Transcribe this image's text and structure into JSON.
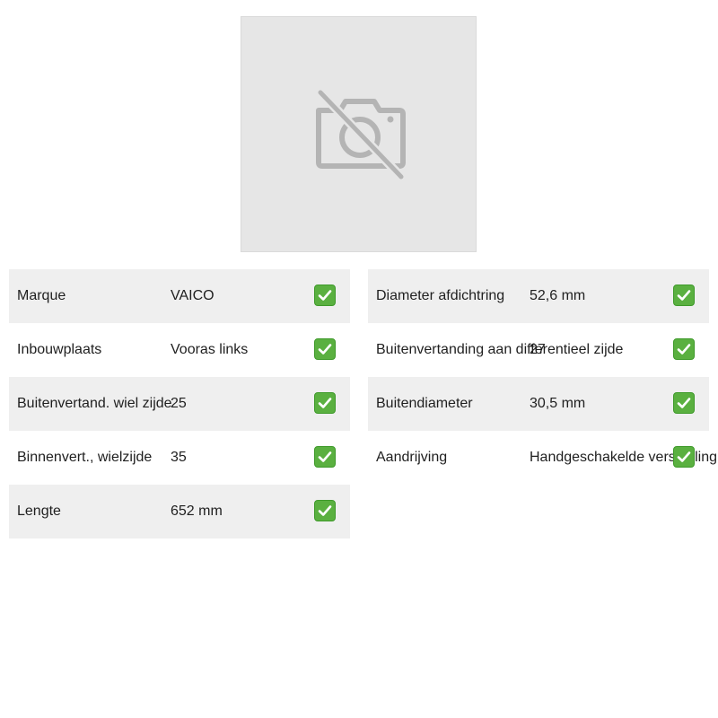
{
  "image": {
    "icon": "camera-off-icon"
  },
  "left_specs": [
    {
      "label": "Marque",
      "value": "VAICO",
      "checked": true
    },
    {
      "label": "Inbouwplaats",
      "value": "Vooras links",
      "checked": true
    },
    {
      "label": "Buitenvertand. wiel zijde",
      "value": "25",
      "checked": true
    },
    {
      "label": "Binnenvert., wielzijde",
      "value": "35",
      "checked": true
    },
    {
      "label": "Lengte",
      "value": "652 mm",
      "checked": true
    }
  ],
  "right_specs": [
    {
      "label": "Diameter afdichtring",
      "value": "52,6 mm",
      "checked": true
    },
    {
      "label": "Buitenvertanding aan differentieel zijde",
      "value": "27",
      "checked": true
    },
    {
      "label": "Buitendiameter",
      "value": "30,5 mm",
      "checked": true
    },
    {
      "label": "Aandrijving",
      "value": "Handgeschakelde versnelling",
      "checked": true
    }
  ],
  "colors": {
    "row_shade": "#efefef",
    "placeholder_bg": "#e6e6e6",
    "placeholder_icon": "#b4b4b4",
    "check_green": "#5ab040"
  }
}
